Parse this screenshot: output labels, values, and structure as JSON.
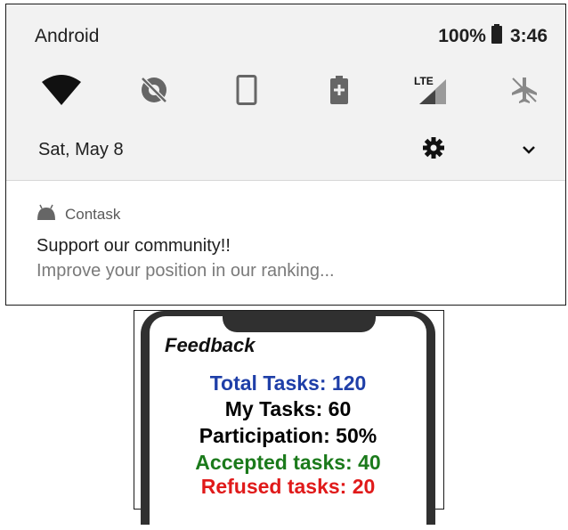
{
  "status_bar": {
    "carrier": "Android",
    "battery": "100%",
    "time": "3:46"
  },
  "quick_settings": {
    "tiles": [
      "wifi-icon",
      "data-saver-off-icon",
      "auto-rotate-icon",
      "battery-saver-icon",
      "lte-signal-icon",
      "airplane-mode-icon"
    ],
    "date": "Sat, May 8"
  },
  "notification": {
    "app_name": "Contask",
    "title": "Support our community!!",
    "text": "Improve your position in our ranking..."
  },
  "feedback": {
    "title": "Feedback",
    "total": "Total Tasks: 120",
    "mine": "My Tasks: 60",
    "participation": "Participation: 50%",
    "accepted": "Accepted tasks: 40",
    "refused": "Refused tasks: 20"
  },
  "colors": {
    "total": "#1f3fa8",
    "mine": "#000000",
    "participation": "#000000",
    "accepted": "#1b7a1b",
    "refused": "#e01a1a"
  }
}
